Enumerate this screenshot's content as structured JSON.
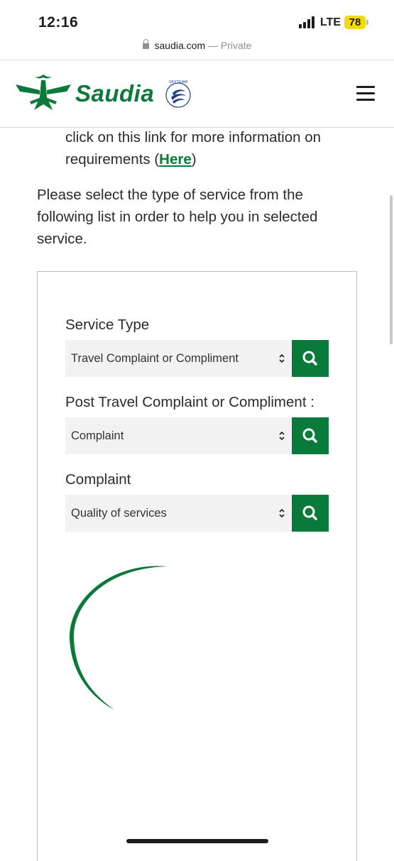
{
  "status": {
    "time": "12:16",
    "network": "LTE",
    "battery": "78"
  },
  "browser": {
    "domain": "saudia.com",
    "separator": " — ",
    "mode": "Private"
  },
  "header": {
    "brand": "Saudia",
    "skyteam_mark": "SKYTEAM",
    "menu_icon": "hamburger-menu-icon"
  },
  "requirements": {
    "text_before": "click on this link for more information on requirements (",
    "link_label": "Here",
    "text_after": ")"
  },
  "intro_text": "Please select the type of service from the following list in order to help you in selected service.",
  "form": {
    "fields": [
      {
        "label": "Service Type",
        "value": "Travel Complaint or Compliment"
      },
      {
        "label": "Post Travel Complaint or Compliment :",
        "value": "Complaint"
      },
      {
        "label": "Complaint",
        "value": "Quality of services"
      }
    ]
  },
  "colors": {
    "brand_green": "#0a7a3a",
    "select_bg": "#f2f2f2",
    "battery": "#f5d90a"
  }
}
